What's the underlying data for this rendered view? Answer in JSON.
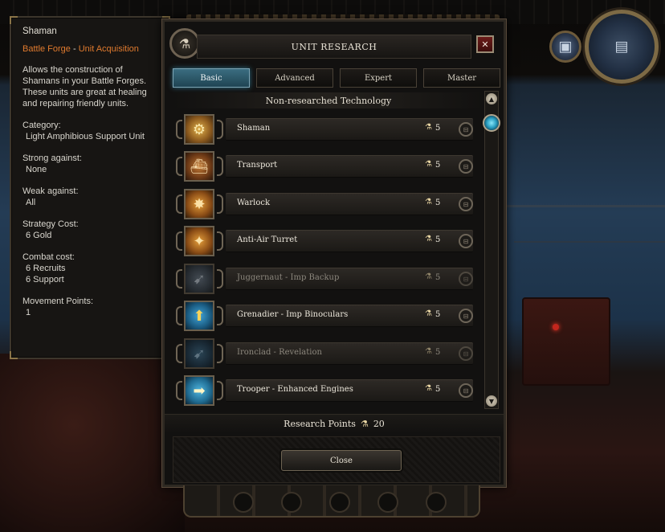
{
  "tooltip": {
    "title": "Shaman",
    "category_link_1": "Battle Forge",
    "separator": " - ",
    "category_link_2": "Unit Acquisition",
    "description": "Allows the construction of Shamans in your Battle Forges. These units are great at healing and repairing friendly units.",
    "stats": [
      {
        "label": "Category:",
        "value": "Light Amphibious Support Unit"
      },
      {
        "label": "Strong against:",
        "value": "None"
      },
      {
        "label": "Weak against:",
        "value": "All"
      },
      {
        "label": "Strategy Cost:",
        "value": "6 Gold"
      },
      {
        "label": "Combat cost:",
        "value": "6 Recruits",
        "value2": "6 Support"
      },
      {
        "label": "Movement Points:",
        "value": "1"
      }
    ]
  },
  "window": {
    "title": "UNIT RESEARCH",
    "close_x": "✕",
    "gear_icon": "⚗",
    "tabs": [
      {
        "label": "Basic",
        "active": true
      },
      {
        "label": "Advanced",
        "active": false
      },
      {
        "label": "Expert",
        "active": false
      },
      {
        "label": "Master",
        "active": false
      }
    ],
    "section_header": "Non-researched Technology",
    "items": [
      {
        "name": "Shaman",
        "cost": "5",
        "icon": "⚙",
        "style": "t-gold",
        "dim": false
      },
      {
        "name": "Transport",
        "cost": "5",
        "icon": "⛴",
        "style": "t-brown",
        "dim": false
      },
      {
        "name": "Warlock",
        "cost": "5",
        "icon": "✸",
        "style": "t-orange",
        "dim": false
      },
      {
        "name": "Anti-Air Turret",
        "cost": "5",
        "icon": "✦",
        "style": "t-orange",
        "dim": false
      },
      {
        "name": "Juggernaut - Imp Backup",
        "cost": "5",
        "icon": "➹",
        "style": "t-gray",
        "dim": true
      },
      {
        "name": "Grenadier - Imp Binoculars",
        "cost": "5",
        "icon": "⬆",
        "style": "t-blue",
        "dim": false
      },
      {
        "name": "Ironclad - Revelation",
        "cost": "5",
        "icon": "➹",
        "style": "t-blue2",
        "dim": true
      },
      {
        "name": "Trooper - Enhanced Engines",
        "cost": "5",
        "icon": "➡",
        "style": "t-blue3",
        "dim": false
      }
    ],
    "cost_icon": "⚗",
    "research_points_label": "Research Points",
    "research_points_value": "20",
    "close_label": "Close"
  },
  "hud": {
    "small_icon": "▣",
    "big_icon": "▤"
  },
  "colors": {
    "accent_tab": "#3b6d80",
    "link_orange": "#e07a2e",
    "close_red": "#6b1b19"
  }
}
